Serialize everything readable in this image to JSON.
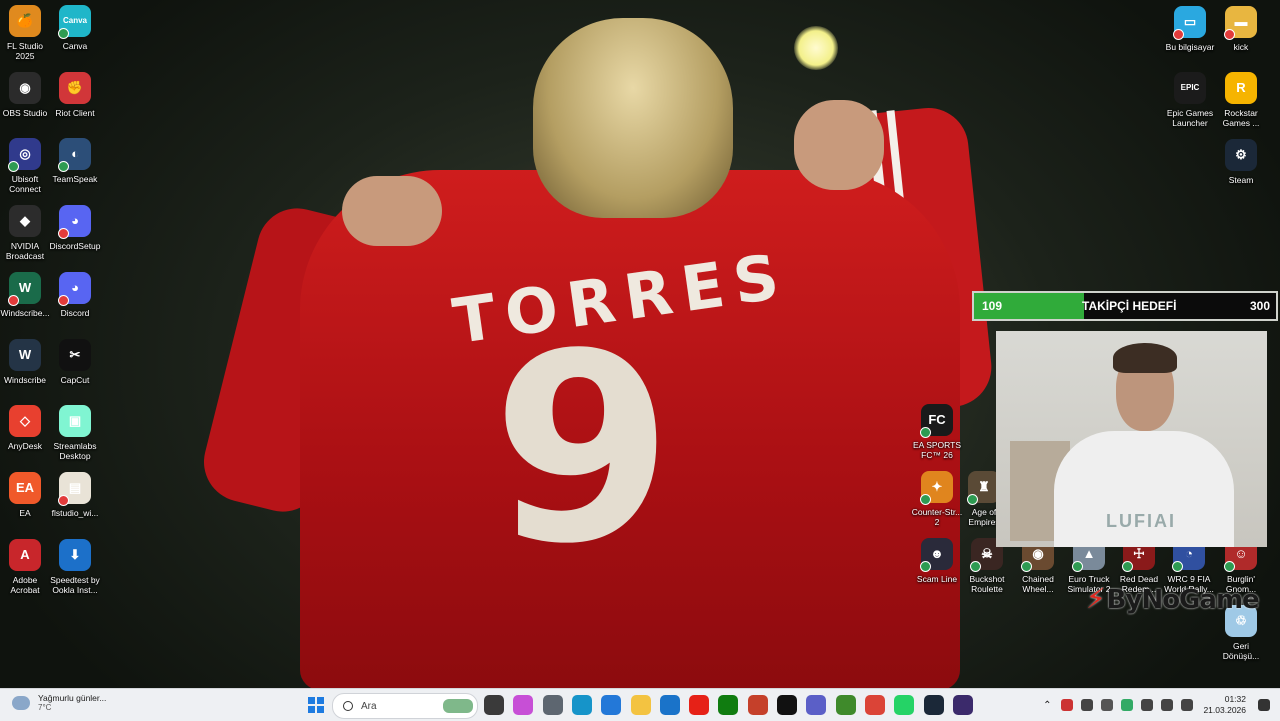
{
  "desktop": {
    "icons_left": [
      {
        "label": "FL Studio 2025",
        "color": "#e08a1e",
        "glyph": "🍊",
        "badge": "none"
      },
      {
        "label": "Canva",
        "color": "#1fb6c9",
        "glyph": "Canva",
        "badge": "check"
      },
      {
        "label": "OBS Studio",
        "color": "#2b2b2b",
        "glyph": "◉",
        "badge": "none"
      },
      {
        "label": "Riot Client",
        "color": "#d13639",
        "glyph": "✊",
        "badge": "none"
      },
      {
        "label": "Ubisoft Connect",
        "color": "#303a8c",
        "glyph": "◎",
        "badge": "check"
      },
      {
        "label": "TeamSpeak",
        "color": "#2c4e78",
        "glyph": "◐",
        "badge": "check"
      },
      {
        "label": "NVIDIA Broadcast",
        "color": "#2c2c2c",
        "glyph": "◆",
        "badge": "none"
      },
      {
        "label": "DiscordSetup",
        "color": "#5865f2",
        "glyph": "◕",
        "badge": "x"
      },
      {
        "label": "Windscribe...",
        "color": "#1a6b4a",
        "glyph": "W",
        "badge": "x"
      },
      {
        "label": "Discord",
        "color": "#5865f2",
        "glyph": "◕",
        "badge": "x"
      },
      {
        "label": "Windscribe",
        "color": "#243446",
        "glyph": "W",
        "badge": "none"
      },
      {
        "label": "CapCut",
        "color": "#111111",
        "glyph": "✂",
        "badge": "none"
      },
      {
        "label": "AnyDesk",
        "color": "#e8402f",
        "glyph": "◇",
        "badge": "none"
      },
      {
        "label": "Streamlabs Desktop",
        "color": "#80f5d2",
        "glyph": "▣",
        "badge": "none"
      },
      {
        "label": "EA",
        "color": "#f0592a",
        "glyph": "EA",
        "badge": "none"
      },
      {
        "label": "flstudio_wi...",
        "color": "#e9e3d7",
        "glyph": "▤",
        "badge": "x"
      },
      {
        "label": "Adobe Acrobat",
        "color": "#c8262b",
        "glyph": "A",
        "badge": "none"
      },
      {
        "label": "Speedtest by Ookla Inst...",
        "color": "#1c70c9",
        "glyph": "⬇",
        "badge": "none"
      }
    ],
    "icons_right": [
      {
        "label": "Bu bilgisayar",
        "color": "#2aa8e0",
        "glyph": "▭",
        "badge": "x"
      },
      {
        "label": "kick",
        "color": "#e8b640",
        "glyph": "▬",
        "badge": "x"
      },
      {
        "label": "Epic Games Launcher",
        "color": "#1b1b1b",
        "glyph": "EPIC",
        "badge": "none"
      },
      {
        "label": "Rockstar Games ...",
        "color": "#f6b400",
        "glyph": "R",
        "badge": "none"
      },
      {
        "label": "Steam",
        "color": "#1b2838",
        "glyph": "⚙",
        "badge": "none"
      }
    ],
    "icons_games": [
      {
        "label": "EA SPORTS FC™ 26",
        "color": "#1a1a1a",
        "glyph": "FC",
        "badge": "check"
      },
      {
        "label": "Counter-Str... 2",
        "color": "#e0851e",
        "glyph": "✦",
        "badge": "check"
      },
      {
        "label": "Age of Empires",
        "color": "#5a4a36",
        "glyph": "♜",
        "badge": "check"
      },
      {
        "label": "Scam Line",
        "color": "#2a2a3a",
        "glyph": "☻",
        "badge": "check"
      },
      {
        "label": "Buckshot Roulette",
        "color": "#3a2622",
        "glyph": "☠",
        "badge": "check"
      },
      {
        "label": "Chained Wheel...",
        "color": "#6a4a30",
        "glyph": "◉",
        "badge": "check"
      },
      {
        "label": "Euro Truck Simulator 2",
        "color": "#7a8a9a",
        "glyph": "▲",
        "badge": "check"
      },
      {
        "label": "Red Dead Redem...",
        "color": "#8a1a1a",
        "glyph": "☩",
        "badge": "check"
      },
      {
        "label": "WRC 9 FIA World Rally...",
        "color": "#3050a0",
        "glyph": "◔",
        "badge": "check"
      },
      {
        "label": "Burglin' Gnom...",
        "color": "#b02a2a",
        "glyph": "☺",
        "badge": "check"
      }
    ],
    "recycle_bin": {
      "label": "Geri Dönüşü...",
      "color": "#9fc9e6",
      "glyph": "♲"
    }
  },
  "overlay": {
    "goal_current": "109",
    "goal_label": "TAKİPÇİ HEDEFİ",
    "goal_target": "300",
    "goal_fraction": 0.3633,
    "webcam_shirt_text": "LUFIAI",
    "brand": "ByNoGame"
  },
  "wallpaper": {
    "jersey_name": "TORRES",
    "jersey_number": "9"
  },
  "taskbar": {
    "weather_title": "Yağmurlu günler...",
    "weather_temp": "7°C",
    "search_placeholder": "Ara",
    "pinned": [
      {
        "name": "task-view",
        "color": "#3a3a3a"
      },
      {
        "name": "copilot",
        "color": "#c74fd6"
      },
      {
        "name": "calculator",
        "color": "#5d6670"
      },
      {
        "name": "edge",
        "color": "#1694c9"
      },
      {
        "name": "store",
        "color": "#2378d8"
      },
      {
        "name": "file-explorer",
        "color": "#f3c341"
      },
      {
        "name": "outlook",
        "color": "#1a73c9"
      },
      {
        "name": "youtube",
        "color": "#e62117"
      },
      {
        "name": "xbox",
        "color": "#107c10"
      },
      {
        "name": "game-app",
        "color": "#c5402a"
      },
      {
        "name": "tiktok",
        "color": "#111111"
      },
      {
        "name": "teams",
        "color": "#5b5fc7"
      },
      {
        "name": "minecraft",
        "color": "#3f8a2b"
      },
      {
        "name": "chrome",
        "color": "#db4437"
      },
      {
        "name": "whatsapp",
        "color": "#25d366"
      },
      {
        "name": "steam",
        "color": "#1b2838"
      },
      {
        "name": "obs",
        "color": "#3b2a6b"
      }
    ],
    "time": "01:32",
    "date": "21.03.2026"
  }
}
